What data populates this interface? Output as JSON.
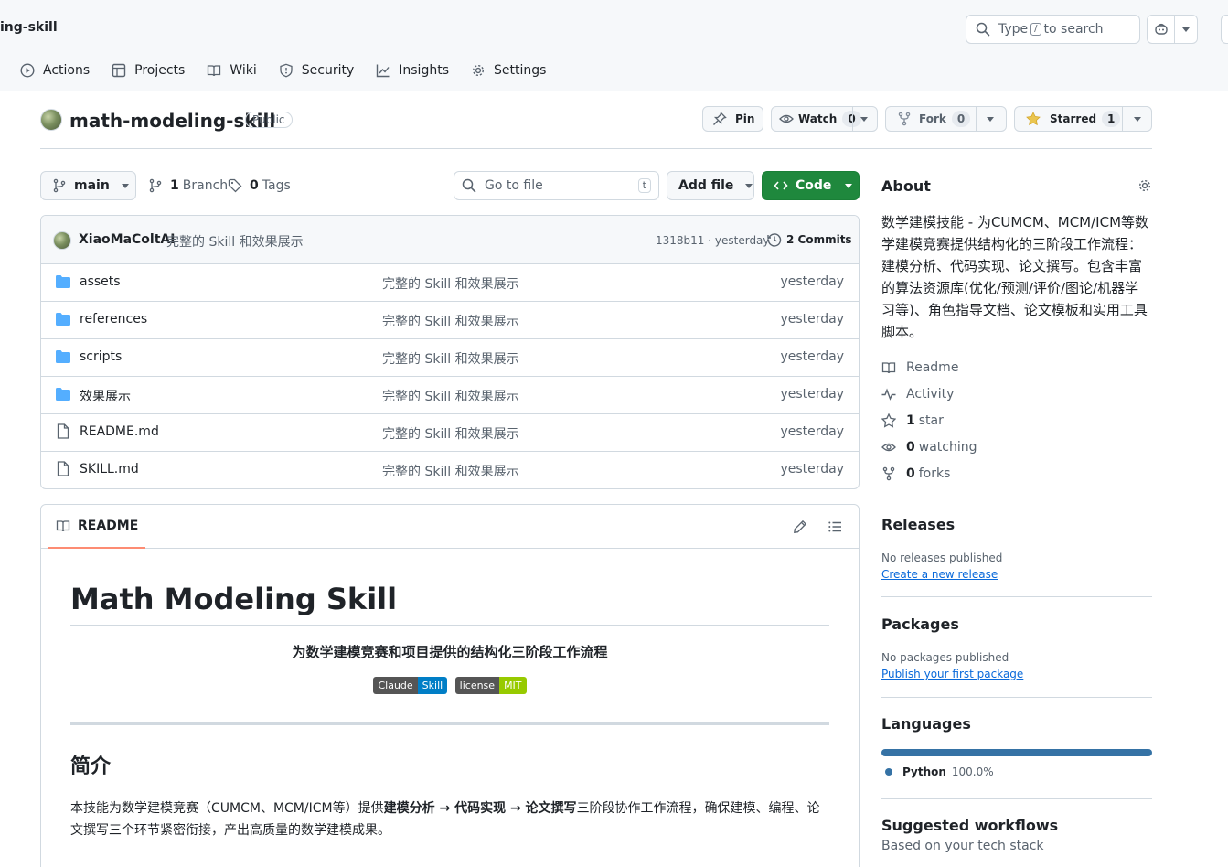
{
  "header": {
    "repo_crumb": "ing-skill",
    "search": {
      "prefix": "Type",
      "key": "/",
      "suffix": "to search"
    },
    "nav_tabs": [
      {
        "label": "Actions",
        "icon": "play-circle-icon"
      },
      {
        "label": "Projects",
        "icon": "table-icon"
      },
      {
        "label": "Wiki",
        "icon": "book-icon"
      },
      {
        "label": "Security",
        "icon": "shield-icon"
      },
      {
        "label": "Insights",
        "icon": "graph-icon"
      },
      {
        "label": "Settings",
        "icon": "gear-icon"
      }
    ]
  },
  "repo": {
    "name": "math-modeling-skill",
    "visibility": "Public",
    "pin_label": "Pin",
    "watch_label": "Watch",
    "watch_count": "0",
    "fork_label": "Fork",
    "fork_count": "0",
    "star_label": "Starred",
    "star_count": "1"
  },
  "toolbar": {
    "branch": "main",
    "branch_count": "1",
    "branch_label": "Branch",
    "tag_count": "0",
    "tag_label": "Tags",
    "goto_placeholder": "Go to file",
    "goto_key": "t",
    "add_file": "Add file",
    "code": "Code"
  },
  "commit": {
    "author": "XiaoMaColtAI",
    "message": "完整的 Skill 和效果展示",
    "hash": "1318b11",
    "time": "yesterday",
    "count": "2 Commits"
  },
  "files": [
    {
      "name": "assets",
      "type": "folder",
      "message": "完整的 Skill 和效果展示",
      "date": "yesterday"
    },
    {
      "name": "references",
      "type": "folder",
      "message": "完整的 Skill 和效果展示",
      "date": "yesterday"
    },
    {
      "name": "scripts",
      "type": "folder",
      "message": "完整的 Skill 和效果展示",
      "date": "yesterday"
    },
    {
      "name": "效果展示",
      "type": "folder",
      "message": "完整的 Skill 和效果展示",
      "date": "yesterday"
    },
    {
      "name": "README.md",
      "type": "file",
      "message": "完整的 Skill 和效果展示",
      "date": "yesterday"
    },
    {
      "name": "SKILL.md",
      "type": "file",
      "message": "完整的 Skill 和效果展示",
      "date": "yesterday"
    }
  ],
  "readme": {
    "tab": "README",
    "title": "Math Modeling Skill",
    "subtitle": "为数学建模竞赛和项目提供的结构化三阶段工作流程",
    "badges": [
      {
        "left": "Claude",
        "right": "Skill",
        "color": "#007ec6"
      },
      {
        "left": "license",
        "right": "MIT",
        "color": "#97ca00"
      }
    ],
    "section_title": "简介",
    "intro_pre": "本技能为数学建模竞赛（CUMCM、MCM/ICM等）提供",
    "intro_bold": "建模分析 → 代码实现 → 论文撰写",
    "intro_post": "三阶段协作工作流程，确保建模、编程、论文撰写三个环节紧密衔接，产出高质量的数学建模成果。"
  },
  "sidebar": {
    "about_title": "About",
    "description": "数学建模技能 - 为CUMCM、MCM/ICM等数学建模竞赛提供结构化的三阶段工作流程：建模分析、代码实现、论文撰写。包含丰富的算法资源库(优化/预测/评价/图论/机器学习等)、角色指导文档、论文模板和实用工具脚本。",
    "readme_link": "Readme",
    "activity_link": "Activity",
    "stars_count": "1",
    "stars_label": "star",
    "watching_count": "0",
    "watching_label": "watching",
    "forks_count": "0",
    "forks_label": "forks",
    "releases_title": "Releases",
    "releases_empty": "No releases published",
    "releases_link": "Create a new release",
    "packages_title": "Packages",
    "packages_empty": "No packages published",
    "packages_link": "Publish your first package",
    "languages_title": "Languages",
    "language_name": "Python",
    "language_percent": "100.0%",
    "language_share": 1.0,
    "language_color": "#3572a5",
    "workflows_title": "Suggested workflows",
    "workflows_sub": "Based on your tech stack"
  }
}
